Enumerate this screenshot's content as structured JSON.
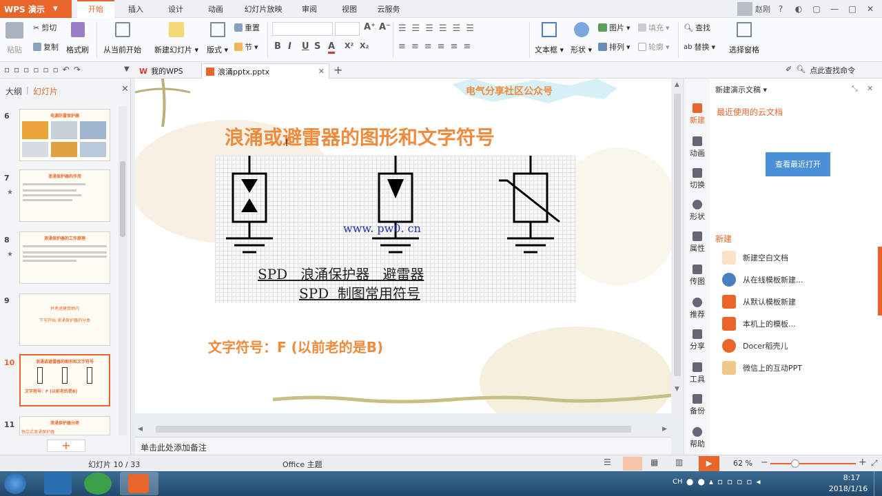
{
  "app": {
    "logo_label": "WPS 演示",
    "menu_tabs": [
      "开始",
      "插入",
      "设计",
      "动画",
      "幻灯片放映",
      "审阅",
      "视图",
      "云服务"
    ],
    "user_name": "赵刚"
  },
  "ribbon": {
    "paste": "粘贴",
    "cut": "剪切",
    "copy": "复制",
    "format_painter": "格式刷",
    "from_current": "从当前开始",
    "new_slide": "新建幻灯片",
    "layout": "版式",
    "reset": "重置",
    "section": "节",
    "bold": "B",
    "italic": "I",
    "underline": "U",
    "strike": "S",
    "font_color": "A",
    "superscript": "X²",
    "subscript": "X₂",
    "textbox": "文本框",
    "shape": "形状",
    "picture": "图片",
    "fill": "填充",
    "arrange": "排列",
    "outline": "轮廓",
    "find": "查找",
    "replace": "替换",
    "select_pane": "选择窗格"
  },
  "quickbar": {
    "tab_mywps": "我的WPS",
    "tab_doc": "浪涌pptx.pptx",
    "search_label": "点此查找命令"
  },
  "left_panel": {
    "tab_outline": "大纲",
    "tab_slides": "幻灯片",
    "slide_numbers": [
      "6",
      "7",
      "8",
      "9",
      "10",
      "11"
    ],
    "thumb_titles": [
      "电源防雷保护器",
      "浪涌保护器的作用",
      "浪涌保护器的工作原理",
      "并考虑建筑物内",
      "浪涌或避雷器的图形和文字符号",
      "浪涌保护器分类"
    ],
    "thumb9_sub": "下节开始:浪涌保护器的分类",
    "thumb10_sub": "文字符号：F (以前老的是B)",
    "thumb11_sub": "独立式浪涌保护器"
  },
  "slide": {
    "banner": "电气分享社区公众号",
    "title": "浪涌或避雷器的图形和文字符号",
    "url_text": "www. pw0. cn",
    "caption1": "SPD   浪涌保护器   避雷器",
    "caption2": "SPD  制图常用符号",
    "bottom_text": "文字符号：F (以前老的是B)"
  },
  "notes_placeholder": "单击此处添加备注",
  "right_tools": [
    "新建",
    "动画",
    "切换",
    "形状",
    "属性",
    "传图",
    "推荐",
    "分享",
    "工具",
    "备份",
    "帮助"
  ],
  "right_panel": {
    "header": "新建演示文稿",
    "recent_cloud": "最近使用的云文档",
    "view_recent": "查看最近打开",
    "new_section": "新建",
    "items": [
      "新建空白文档",
      "从在线模板新建...",
      "从默认模板新建",
      "本机上的模板...",
      "Docer稻壳儿",
      "微信上的互动PPT"
    ]
  },
  "statusbar": {
    "slide_info": "幻灯片 10 / 33",
    "theme": "Office 主题",
    "zoom": "62 %"
  },
  "taskbar": {
    "time": "8:17",
    "date": "2018/1/16",
    "lang": "CH"
  },
  "colors": {
    "accent": "#e8662b",
    "title_orange": "#f08a3c",
    "button_blue": "#4a90d9"
  }
}
